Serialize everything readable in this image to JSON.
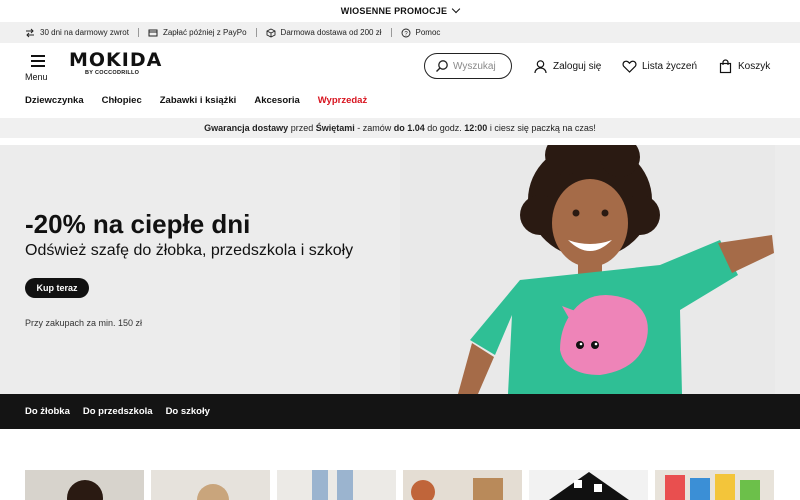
{
  "promo_bar": {
    "label": "WIOSENNE PROMOCJE"
  },
  "benefits": [
    {
      "label": "30 dni na darmowy zwrot",
      "icon": "return-arrows-icon"
    },
    {
      "label": "Zapłać później z PayPo",
      "icon": "card-icon"
    },
    {
      "label": "Darmowa dostawa od 200 zł",
      "icon": "package-icon"
    },
    {
      "label": "Pomoc",
      "icon": "help-icon"
    }
  ],
  "header": {
    "menu_label": "Menu",
    "logo_main": "MOKIDA",
    "logo_sub": "BY COCCODRILLO",
    "search_placeholder": "Wyszukaj",
    "login_label": "Zaloguj się",
    "wishlist_label": "Lista życzeń",
    "cart_label": "Koszyk"
  },
  "nav": {
    "items": [
      "Dziewczynka",
      "Chłopiec",
      "Zabawki i książki",
      "Akcesoria",
      "Wyprzedaż"
    ],
    "sale_color": "#d8141f"
  },
  "delivery_bar": {
    "p1": "Gwarancja dostawy",
    "p2": " przed ",
    "p3": "Świętami",
    "p4": " - zamów ",
    "p5": "do 1.04",
    "p6": " do godz. ",
    "p7": "12:00",
    "p8": " i ciesz się paczką na czas!"
  },
  "hero": {
    "title": "-20% na ciepłe dni",
    "subtitle": "Odśwież szafę do żłobka, przedszkola i szkoły",
    "button": "Kup teraz",
    "note": "Przy zakupach za min. 150 zł",
    "shirt_color": "#2fbf95",
    "cat_color": "#ee84b8"
  },
  "categories": [
    "Do żłobka",
    "Do przedszkola",
    "Do szkoły"
  ],
  "colors": {
    "accent_dark": "#141414",
    "bar_gray": "#f0f0f0"
  }
}
